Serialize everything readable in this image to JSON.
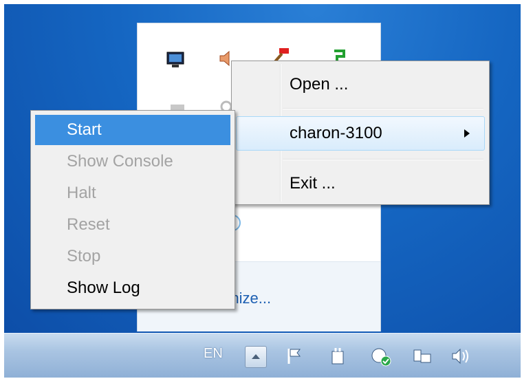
{
  "desktop": {
    "background": "#1566c2"
  },
  "tray_panel": {
    "customize_text": "stomize..."
  },
  "context_menu": {
    "items": [
      {
        "label": "Open ..."
      },
      {
        "label": "charon-3100",
        "has_submenu": true
      },
      {
        "label": "Exit ..."
      }
    ]
  },
  "submenu": {
    "items": [
      {
        "label": "Start",
        "enabled": true,
        "selected": true
      },
      {
        "label": "Show Console",
        "enabled": false
      },
      {
        "label": "Halt",
        "enabled": false
      },
      {
        "label": "Reset",
        "enabled": false
      },
      {
        "label": "Stop",
        "enabled": false
      },
      {
        "label": "Show Log",
        "enabled": true
      }
    ]
  },
  "taskbar": {
    "language": "EN",
    "tray_icons": [
      "action-center-flag-icon",
      "power-plug-icon",
      "network-sync-icon",
      "network-monitor-icon",
      "volume-icon"
    ]
  }
}
